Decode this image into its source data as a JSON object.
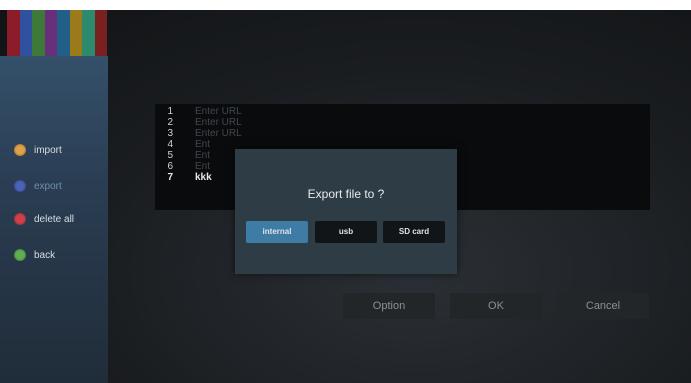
{
  "sidebar": {
    "items": [
      {
        "label": "import",
        "color": "#e0a14a"
      },
      {
        "label": "export",
        "color": "#4b63b7"
      },
      {
        "label": "delete all",
        "color": "#d0404a"
      },
      {
        "label": "back",
        "color": "#5fae54"
      }
    ]
  },
  "list": {
    "rows": [
      {
        "num": "1",
        "value": "Enter URL"
      },
      {
        "num": "2",
        "value": "Enter URL"
      },
      {
        "num": "3",
        "value": "Enter URL"
      },
      {
        "num": "4",
        "value": "Ent"
      },
      {
        "num": "5",
        "value": "Ent"
      },
      {
        "num": "6",
        "value": "Ent"
      },
      {
        "num": "7",
        "value": "kkk"
      }
    ]
  },
  "dialog": {
    "title": "Export file to ?",
    "buttons": [
      "internal",
      "usb",
      "SD card"
    ]
  },
  "buttons": {
    "option": "Option",
    "ok": "OK",
    "cancel": "Cancel"
  },
  "colors": {
    "stripes": [
      "#8c1c2a",
      "#3050a0",
      "#3d7a3a",
      "#6a2f7a",
      "#1f5f88",
      "#9a7a1a",
      "#2d8b6d",
      "#7a2020"
    ]
  }
}
